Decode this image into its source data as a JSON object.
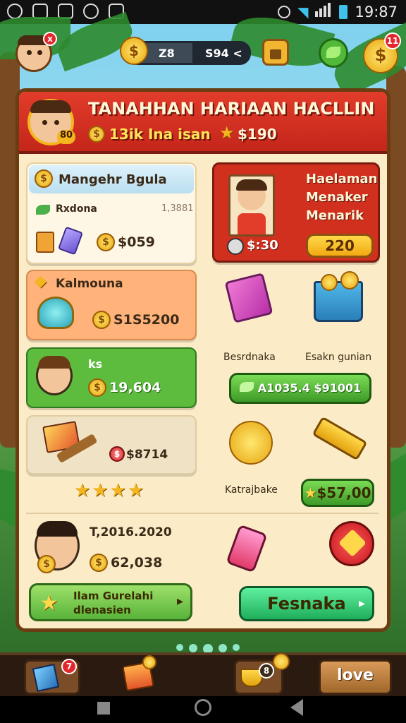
{
  "status_bar": {
    "time": "19:87"
  },
  "hud": {
    "avatar_badge": "x",
    "coin_amount": "Z8",
    "gem_amount": "S94 <",
    "coin_button_badge": "11"
  },
  "header": {
    "level": "80",
    "title": "TANAHHAN HARIAAN HACLLIN",
    "subtitle_text": "13ik Ina isan",
    "subtitle_price": "$190"
  },
  "cards": {
    "card1": {
      "title": "Mangehr Bgula",
      "sub_label": "Rxdona",
      "sub_value": "1,3881",
      "price": "$059"
    },
    "card2": {
      "title": "Kalmouna",
      "price": "S1S5200"
    },
    "card3": {
      "title": "ks",
      "price": "19,604"
    },
    "card4": {
      "price": "$8714",
      "stars": "★★★★"
    },
    "card5": {
      "title": "T,2016.2020",
      "price": "62,038"
    }
  },
  "offer": {
    "line1": "Haelaman",
    "line2": "Menaker",
    "line3": "Menarik",
    "price": "$:30",
    "button": "220"
  },
  "items": {
    "item1_label": "Besrdnaka",
    "item2_label": "Esakn gunian",
    "buy_button": "A1035.4 $91001",
    "item3_label": "Katrajbake",
    "price_button": "$57,00"
  },
  "buttons": {
    "left_line1": "Ilam Gurelahi",
    "left_line2": "dlenasien",
    "right": "Fesnaka"
  },
  "bottom": {
    "tab1_badge": "7",
    "tab3_badge": "8",
    "tab4_label": "love"
  },
  "colors": {
    "header_red": "#d2301f",
    "panel_cream": "#fbecc7",
    "green": "#5dbb3e",
    "gold": "#f4b51f"
  }
}
